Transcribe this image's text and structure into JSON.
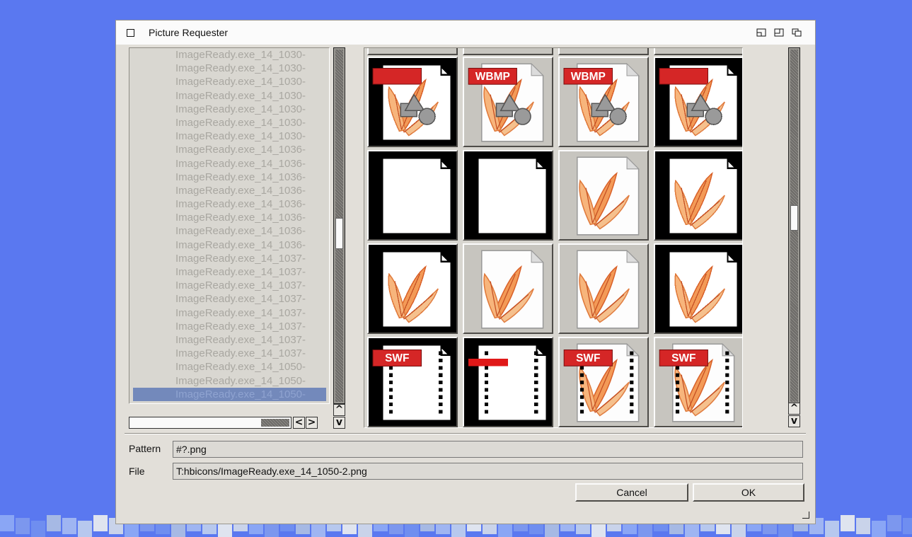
{
  "window": {
    "title": "Picture Requester",
    "controls": [
      "iconify-icon",
      "zoom-icon",
      "depth-icon"
    ]
  },
  "filelist": {
    "items": [
      "ImageReady.exe_14_1030-",
      "ImageReady.exe_14_1030-",
      "ImageReady.exe_14_1030-",
      "ImageReady.exe_14_1030-",
      "ImageReady.exe_14_1030-",
      "ImageReady.exe_14_1030-",
      "ImageReady.exe_14_1030-",
      "ImageReady.exe_14_1036-",
      "ImageReady.exe_14_1036-",
      "ImageReady.exe_14_1036-",
      "ImageReady.exe_14_1036-",
      "ImageReady.exe_14_1036-",
      "ImageReady.exe_14_1036-",
      "ImageReady.exe_14_1036-",
      "ImageReady.exe_14_1036-",
      "ImageReady.exe_14_1037-",
      "ImageReady.exe_14_1037-",
      "ImageReady.exe_14_1037-",
      "ImageReady.exe_14_1037-",
      "ImageReady.exe_14_1037-",
      "ImageReady.exe_14_1037-",
      "ImageReady.exe_14_1037-",
      "ImageReady.exe_14_1037-",
      "ImageReady.exe_14_1050-",
      "ImageReady.exe_14_1050-",
      "ImageReady.exe_14_1050-"
    ],
    "selected_index": 25,
    "scroll_up": "^",
    "scroll_down": "v",
    "scroll_left": "<",
    "scroll_right": ">"
  },
  "thumbnails": {
    "rows": [
      [
        "partial",
        "partial",
        "partial",
        "partial"
      ],
      [
        "pixel-badge",
        "wbmp",
        "wbmp-pixel",
        "pixel-badge"
      ],
      [
        "blank-pixel",
        "blank-pixel",
        "feather-doc",
        "feather-pixel"
      ],
      [
        "feather-pixel",
        "feather-doc",
        "feather-doc",
        "feather-pixel"
      ],
      [
        "swf-pixel",
        "swf-pixel-red",
        "swf",
        "swf"
      ]
    ],
    "badges": {
      "wbmp": "WBMP",
      "swf": "SWF"
    },
    "scroll_up": "^",
    "scroll_down": "v"
  },
  "form": {
    "pattern_label": "Pattern",
    "pattern_value": "#?.png",
    "file_label": "File",
    "file_value": "T:hbicons/ImageReady.exe_14_1050-2.png"
  },
  "buttons": {
    "cancel": "Cancel",
    "ok": "OK"
  },
  "colors": {
    "desktop": "#5a78f0",
    "window": "#e2dfd9",
    "selection": "#7389bb"
  }
}
